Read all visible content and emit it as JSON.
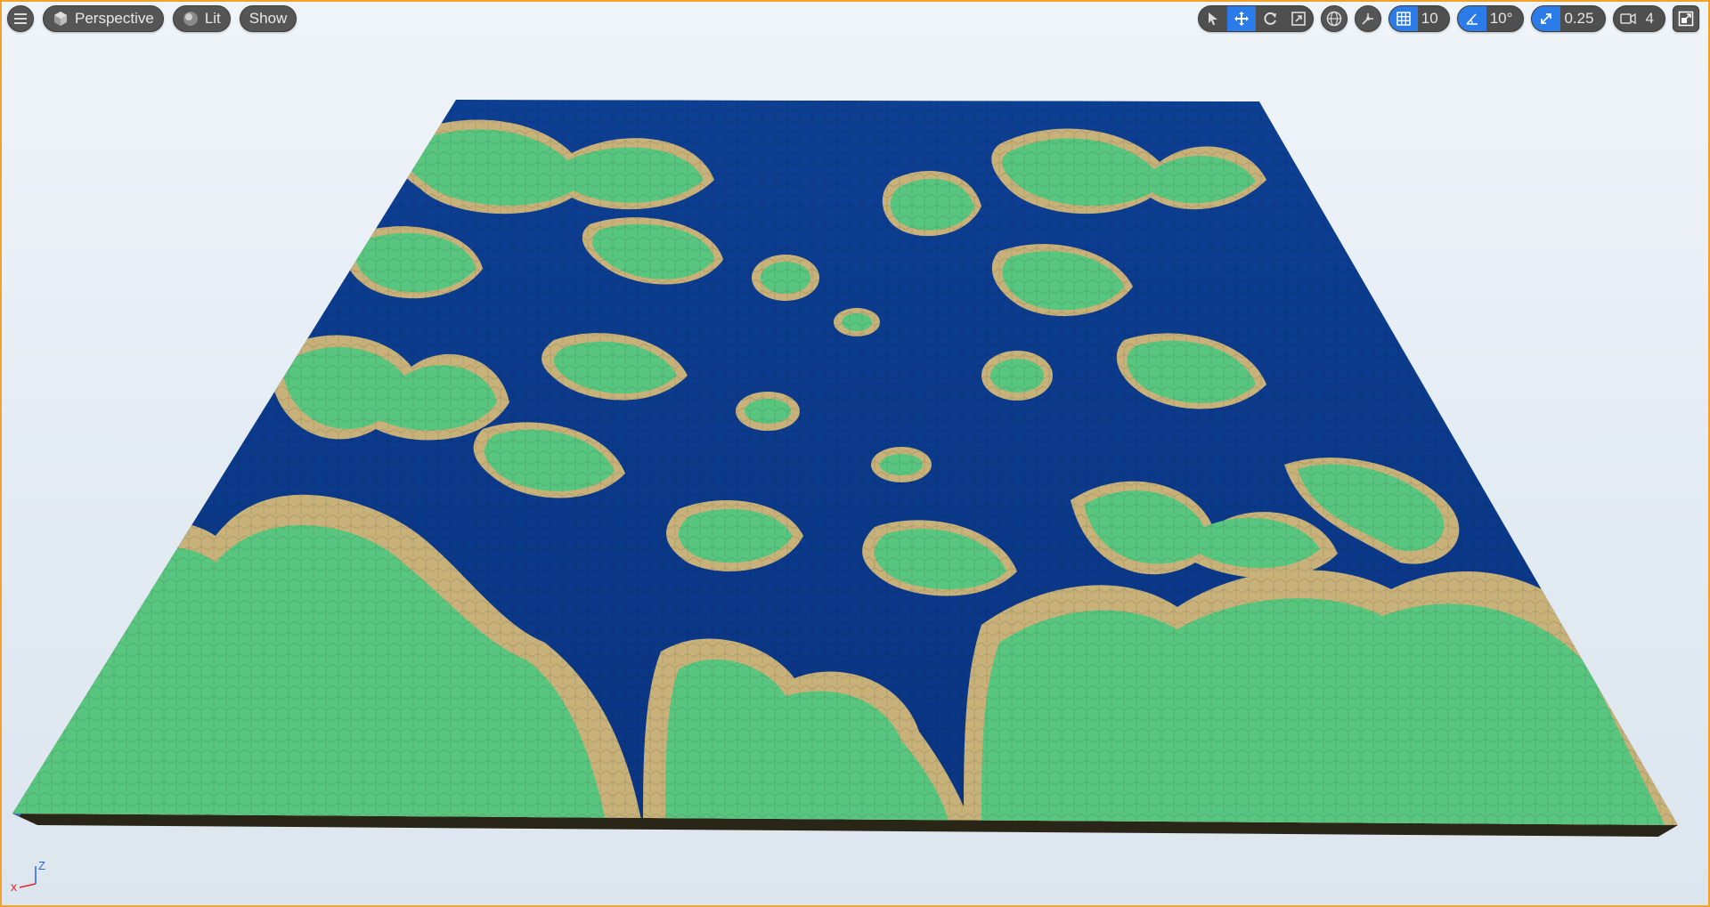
{
  "toolbar": {
    "menu_icon": "hamburger-menu-icon",
    "perspective_label": "Perspective",
    "lit_label": "Lit",
    "show_label": "Show",
    "grid_snap_value": "10",
    "rotation_snap_value": "10°",
    "scale_snap_value": "0.25",
    "camera_speed_value": "4"
  },
  "axis": {
    "x_label": "x",
    "z_label": "Z"
  },
  "colors": {
    "border": "#f0a22a",
    "active": "#2b7be8",
    "water_deep": "#0b3c8f",
    "water_shallow": "#2f6bb8",
    "sand": "#c8b27a",
    "grass": "#58c67f",
    "dirt": "#9b6a2c"
  }
}
